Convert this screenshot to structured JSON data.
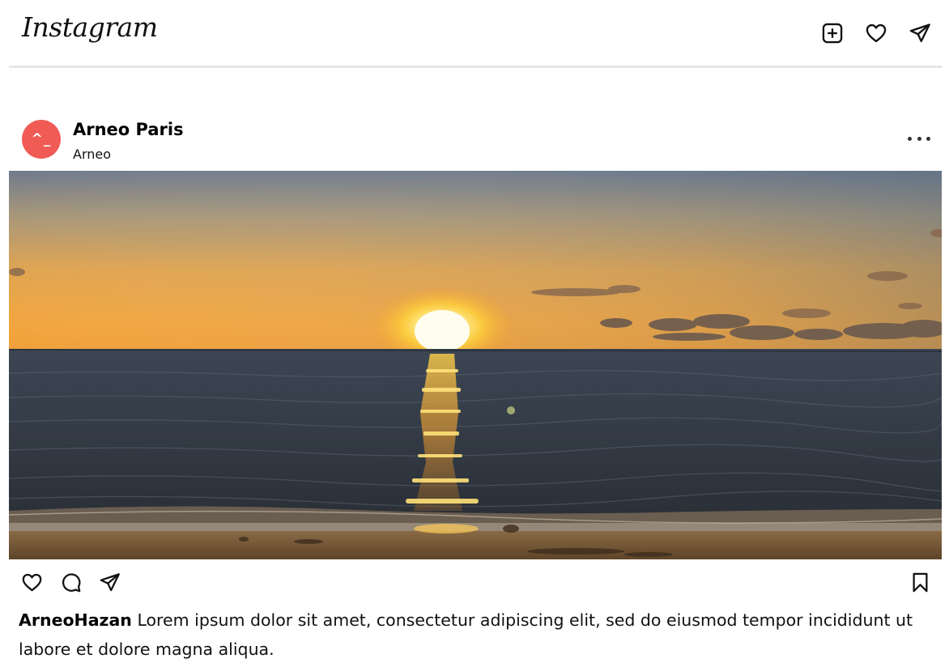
{
  "header": {
    "logo_text": "Instagram",
    "icons": [
      "new-post-icon",
      "heart-icon",
      "direct-message-icon"
    ]
  },
  "post": {
    "avatar_text": "^_",
    "avatar_color": "#f05b55",
    "author_name": "Arneo Paris",
    "author_subtitle": "Arneo",
    "image_subject": "sunset-over-sea",
    "actions": [
      "like-icon",
      "comment-icon",
      "share-icon",
      "bookmark-icon"
    ],
    "caption_user": "ArneoHazan",
    "caption_text": "Lorem ipsum dolor sit amet, consectetur adipiscing elit, sed do eiusmod tempor incididunt ut labore et dolore magna aliqua."
  }
}
